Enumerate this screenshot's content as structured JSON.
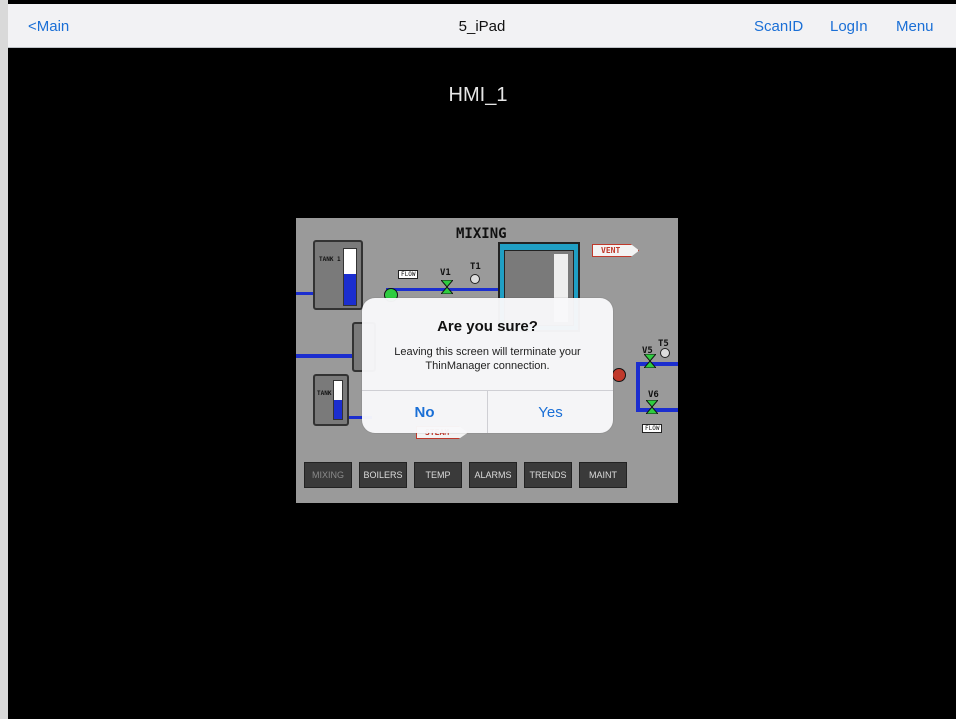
{
  "navbar": {
    "back_label": "<Main",
    "title": "5_iPad",
    "scanid_label": "ScanID",
    "login_label": "LogIn",
    "menu_label": "Menu"
  },
  "hmi_title": "HMI_1",
  "panel": {
    "title": "MIXING",
    "vent_label": "VENT",
    "steam_label": "STEAM",
    "tank1_label": "TANK 1",
    "tank2_label": "TANK 1",
    "tank3_label": "TANK",
    "flow_label": "FLOW",
    "valves": [
      "V1",
      "T1",
      "V5",
      "T5",
      "V6"
    ],
    "nav_buttons": [
      "MIXING",
      "BOILERS",
      "TEMP",
      "ALARMS",
      "TRENDS",
      "MAINT"
    ]
  },
  "dialog": {
    "title": "Are you sure?",
    "message": "Leaving this screen will terminate your ThinManager connection.",
    "no_label": "No",
    "yes_label": "Yes"
  },
  "colors": {
    "accent": "#1a6fd6",
    "pipe": "#1b2ecf",
    "valve": "#2ecc40",
    "alarm": "#c0392b"
  }
}
